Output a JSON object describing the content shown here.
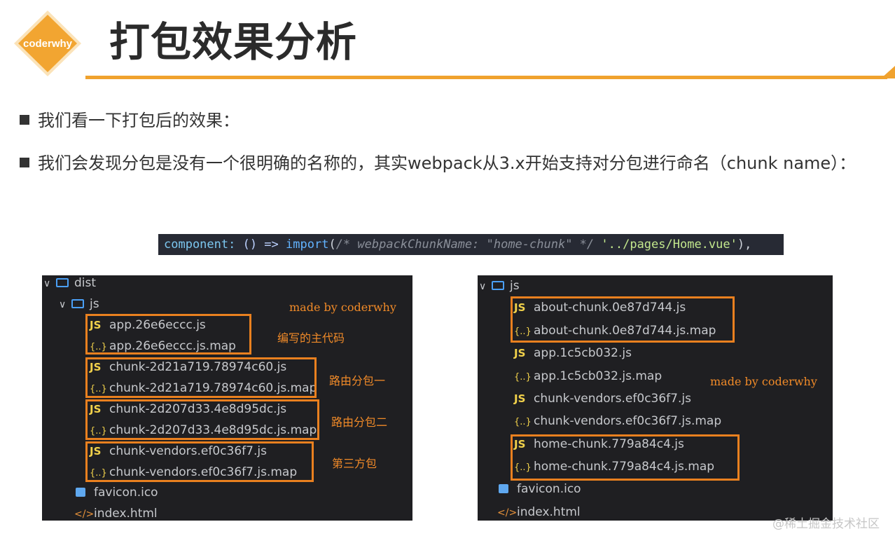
{
  "header": {
    "logo_text": "coderwhy",
    "title": "打包效果分析"
  },
  "bullets": [
    "我们看一下打包后的效果：",
    "我们会发现分包是没有一个很明确的名称的，其实webpack从3.x开始支持对分包进行命名（chunk name）："
  ],
  "code": {
    "key": "component:",
    "arrow": " () => ",
    "import_kw": "import",
    "open": "(",
    "comment": "/* webpackChunkName: \"home-chunk\" */",
    "path": " '../pages/Home.vue'",
    "close": "),"
  },
  "left_tree": {
    "root": "dist",
    "folder": "js",
    "files": [
      {
        "icon": "js-icon",
        "name": "app.26e6eccc.js"
      },
      {
        "icon": "map-icon",
        "name": "app.26e6eccc.js.map"
      },
      {
        "icon": "js-icon",
        "name": "chunk-2d21a719.78974c60.js"
      },
      {
        "icon": "map-icon",
        "name": "chunk-2d21a719.78974c60.js.map"
      },
      {
        "icon": "js-icon",
        "name": "chunk-2d207d33.4e8d95dc.js"
      },
      {
        "icon": "map-icon",
        "name": "chunk-2d207d33.4e8d95dc.js.map"
      },
      {
        "icon": "js-icon",
        "name": "chunk-vendors.ef0c36f7.js"
      },
      {
        "icon": "map-icon",
        "name": "chunk-vendors.ef0c36f7.js.map"
      }
    ],
    "favicon": "favicon.ico",
    "index": "index.html",
    "annotations": {
      "credit": "made by coderwhy",
      "main": "编写的主代码",
      "route1": "路由分包一",
      "route2": "路由分包二",
      "vendor": "第三方包"
    }
  },
  "right_tree": {
    "folder": "js",
    "files": [
      {
        "icon": "js-icon",
        "name": "about-chunk.0e87d744.js"
      },
      {
        "icon": "map-icon",
        "name": "about-chunk.0e87d744.js.map"
      },
      {
        "icon": "js-icon",
        "name": "app.1c5cb032.js"
      },
      {
        "icon": "map-icon",
        "name": "app.1c5cb032.js.map"
      },
      {
        "icon": "js-icon",
        "name": "chunk-vendors.ef0c36f7.js"
      },
      {
        "icon": "map-icon",
        "name": "chunk-vendors.ef0c36f7.js.map"
      },
      {
        "icon": "js-icon",
        "name": "home-chunk.779a84c4.js"
      },
      {
        "icon": "map-icon",
        "name": "home-chunk.779a84c4.js.map"
      }
    ],
    "favicon": "favicon.ico",
    "index": "index.html",
    "credit": "made by coderwhy"
  },
  "icons": {
    "js": "JS",
    "map": "{..}",
    "html": "</>"
  },
  "watermark": "@稀土掘金技术社区",
  "colors": {
    "accent": "#f0a22e",
    "box": "#e9801f",
    "panel_bg": "#1f1f22"
  }
}
